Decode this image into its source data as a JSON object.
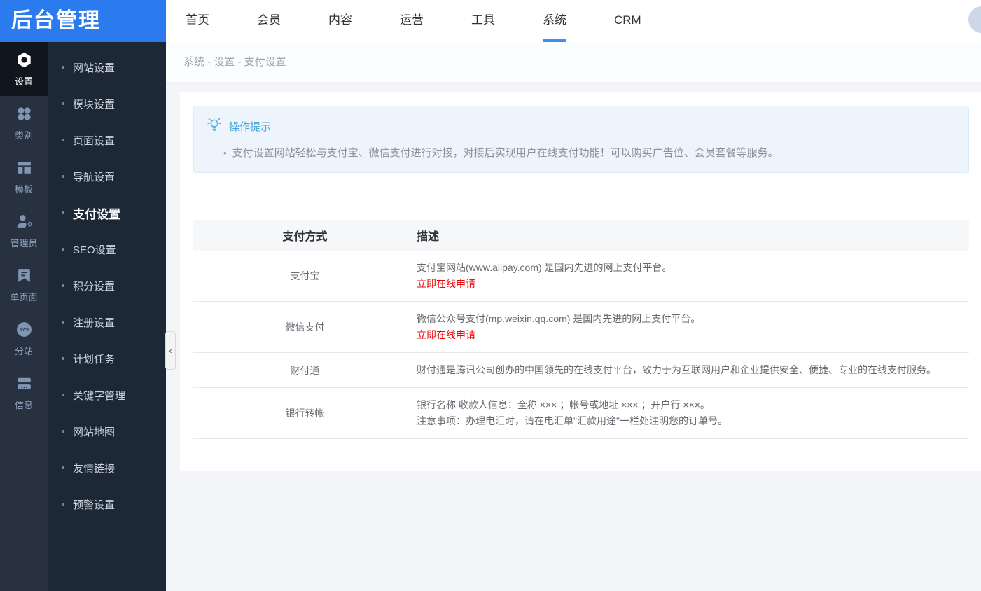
{
  "header": {
    "logo": "后台管理",
    "nav": [
      {
        "id": "home",
        "label": "首页",
        "active": false
      },
      {
        "id": "members",
        "label": "会员",
        "active": false
      },
      {
        "id": "content",
        "label": "内容",
        "active": false
      },
      {
        "id": "operations",
        "label": "运营",
        "active": false
      },
      {
        "id": "tools",
        "label": "工具",
        "active": false
      },
      {
        "id": "system",
        "label": "系统",
        "active": true
      },
      {
        "id": "crm",
        "label": "CRM",
        "active": false
      }
    ]
  },
  "icon_rail": [
    {
      "id": "settings",
      "label": "设置",
      "icon": "gear-icon",
      "active": true
    },
    {
      "id": "category",
      "label": "类别",
      "icon": "category-icon",
      "active": false
    },
    {
      "id": "template",
      "label": "模板",
      "icon": "template-icon",
      "active": false
    },
    {
      "id": "admin",
      "label": "管理员",
      "icon": "admin-user-icon",
      "active": false
    },
    {
      "id": "single-page",
      "label": "单页面",
      "icon": "bookmark-icon",
      "active": false
    },
    {
      "id": "subsite",
      "label": "分站",
      "icon": "globe-www-icon",
      "active": false
    },
    {
      "id": "info",
      "label": "信息",
      "icon": "info-stack-icon",
      "active": false
    }
  ],
  "submenu": [
    {
      "id": "website-settings",
      "label": "网站设置",
      "active": false
    },
    {
      "id": "module-settings",
      "label": "模块设置",
      "active": false
    },
    {
      "id": "page-settings",
      "label": "页面设置",
      "active": false
    },
    {
      "id": "nav-settings",
      "label": "导航设置",
      "active": false
    },
    {
      "id": "payment-settings",
      "label": "支付设置",
      "active": true
    },
    {
      "id": "seo-settings",
      "label": "SEO设置",
      "active": false
    },
    {
      "id": "points-settings",
      "label": "积分设置",
      "active": false
    },
    {
      "id": "register-settings",
      "label": "注册设置",
      "active": false
    },
    {
      "id": "cron-tasks",
      "label": "计划任务",
      "active": false
    },
    {
      "id": "keyword-management",
      "label": "关键字管理",
      "active": false
    },
    {
      "id": "sitemap",
      "label": "网站地图",
      "active": false
    },
    {
      "id": "friend-links",
      "label": "友情链接",
      "active": false
    },
    {
      "id": "alert-settings",
      "label": "预警设置",
      "active": false
    }
  ],
  "breadcrumb": "系统 - 设置 - 支付设置",
  "tip": {
    "title": "操作提示",
    "line": "支付设置网站轻松与支付宝、微信支付进行对接，对接后实现用户在线支付功能！可以购买广告位、会员套餐等服务。"
  },
  "table": {
    "columns": [
      "支付方式",
      "描述"
    ],
    "rows": [
      {
        "name": "支付宝",
        "desc_lines": [
          "支付宝网站(www.alipay.com) 是国内先进的网上支付平台。"
        ],
        "link": "立即在线申请"
      },
      {
        "name": "微信支付",
        "desc_lines": [
          "微信公众号支付(mp.weixin.qq.com) 是国内先进的网上支付平台。"
        ],
        "link": "立即在线申请"
      },
      {
        "name": "财付通",
        "desc_lines": [
          "财付通是腾讯公司创办的中国领先的在线支付平台，致力于为互联网用户和企业提供安全、便捷、专业的在线支付服务。"
        ],
        "link": ""
      },
      {
        "name": "银行转帐",
        "desc_lines": [
          "银行名称 收款人信息：全称 ××× ；帐号或地址 ××× ；开户行 ×××。",
          "注意事项：办理电汇时，请在电汇单\"汇款用途\"一栏处注明您的订单号。"
        ],
        "link": ""
      }
    ]
  },
  "colors": {
    "brand-blue": "#2b7bee",
    "accent": "#3d8ef5",
    "tip-blue": "#46a4dc",
    "link-red": "#f20000"
  }
}
